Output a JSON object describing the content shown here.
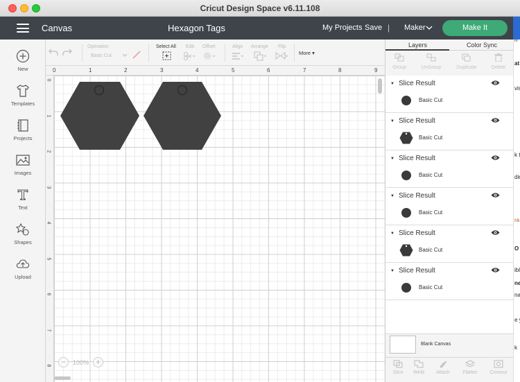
{
  "window": {
    "title": "Cricut Design Space  v6.11.108"
  },
  "header": {
    "section": "Canvas",
    "project_title": "Hexagon Tags",
    "my_projects": "My Projects",
    "save": "Save",
    "separator": "|",
    "machine": "Maker",
    "make_it": "Make It"
  },
  "sidebar": {
    "items": [
      {
        "label": "New",
        "icon": "plus-circle-icon"
      },
      {
        "label": "Templates",
        "icon": "shirt-icon"
      },
      {
        "label": "Projects",
        "icon": "book-icon"
      },
      {
        "label": "Images",
        "icon": "image-icon"
      },
      {
        "label": "Text",
        "icon": "text-t-icon"
      },
      {
        "label": "Shapes",
        "icon": "shapes-icon"
      },
      {
        "label": "Upload",
        "icon": "cloud-upload-icon"
      }
    ]
  },
  "toolbar": {
    "operation_label": "Operation",
    "operation_value": "Basic Cut",
    "select_all": "Select All",
    "edit": "Edit",
    "offset": "Offset",
    "align": "Align",
    "arrange": "Arrange",
    "flip": "Flip",
    "more": "More"
  },
  "canvas": {
    "ruler_top": [
      "0",
      "1",
      "2",
      "3",
      "4",
      "5",
      "6",
      "7",
      "8",
      "9"
    ],
    "ruler_left": [
      "0",
      "1",
      "2",
      "3",
      "4",
      "5",
      "6",
      "7",
      "8"
    ],
    "zoom": "100%",
    "zoom_minus": "−",
    "zoom_plus": "+"
  },
  "panel": {
    "tabs": [
      "Layers",
      "Color Sync"
    ],
    "actions": [
      "Group",
      "UnGroup",
      "Duplicate",
      "Delete"
    ],
    "layers": [
      {
        "name": "Slice Result",
        "cut": "Basic Cut",
        "thumb": "circle"
      },
      {
        "name": "Slice Result",
        "cut": "Basic Cut",
        "thumb": "hexagon"
      },
      {
        "name": "Slice Result",
        "cut": "Basic Cut",
        "thumb": "circle"
      },
      {
        "name": "Slice Result",
        "cut": "Basic Cut",
        "thumb": "circle"
      },
      {
        "name": "Slice Result",
        "cut": "Basic Cut",
        "thumb": "hexagon"
      },
      {
        "name": "Slice Result",
        "cut": "Basic Cut",
        "thumb": "circle"
      }
    ],
    "blank_canvas": "Blank Canvas",
    "bottom_actions": [
      "Slice",
      "Weld",
      "Attach",
      "Flatten",
      "Contour"
    ]
  },
  "background_window": {
    "fragments": [
      "h",
      "at",
      "vis",
      "k t",
      "din",
      "ra",
      "O",
      "ibl",
      "ne",
      "na",
      "e y",
      "k"
    ]
  },
  "colors": {
    "header": "#3e4449",
    "make_it": "#3daa78",
    "shape_fill": "#414141"
  }
}
